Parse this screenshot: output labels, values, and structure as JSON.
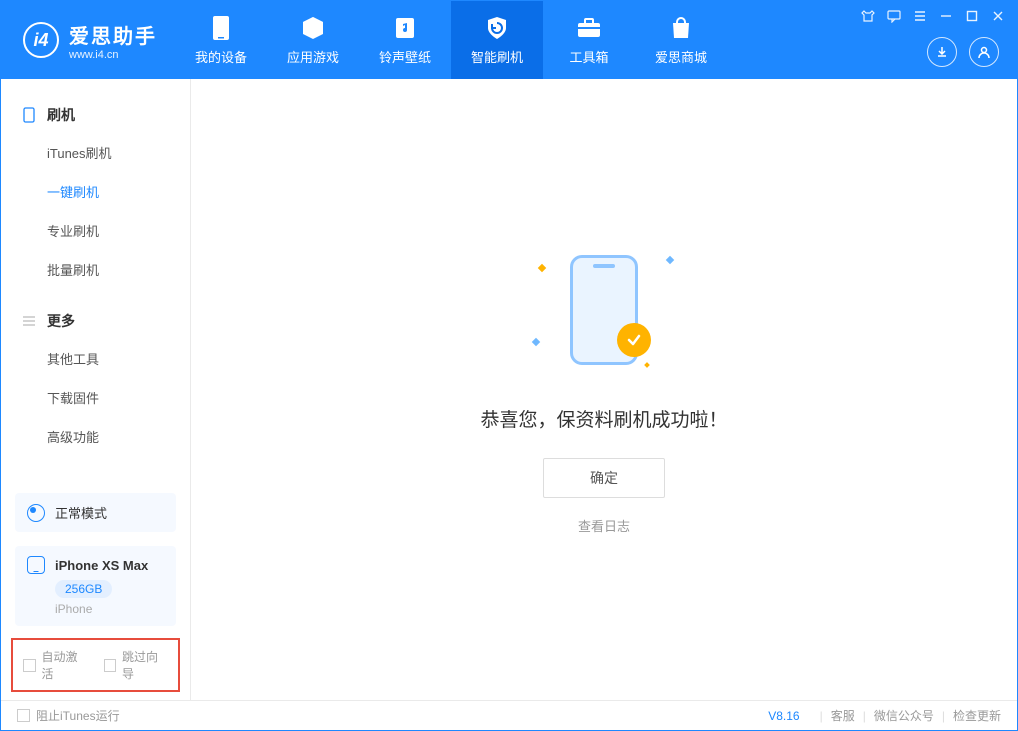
{
  "app": {
    "name": "爱思助手",
    "site": "www.i4.cn"
  },
  "tabs": {
    "device": "我的设备",
    "apps": "应用游戏",
    "ringtone": "铃声壁纸",
    "flash": "智能刷机",
    "toolbox": "工具箱",
    "store": "爱思商城"
  },
  "sidebar": {
    "section1": "刷机",
    "items1": {
      "itunes": "iTunes刷机",
      "onekey": "一键刷机",
      "pro": "专业刷机",
      "batch": "批量刷机"
    },
    "section2": "更多",
    "items2": {
      "other": "其他工具",
      "firmware": "下载固件",
      "advanced": "高级功能"
    }
  },
  "mode": {
    "label": "正常模式"
  },
  "device": {
    "name": "iPhone XS Max",
    "capacity": "256GB",
    "type": "iPhone"
  },
  "opts": {
    "autoActivate": "自动激活",
    "skipGuide": "跳过向导"
  },
  "main": {
    "success": "恭喜您，保资料刷机成功啦！",
    "ok": "确定",
    "log": "查看日志"
  },
  "footer": {
    "blockITunes": "阻止iTunes运行",
    "version": "V8.16",
    "support": "客服",
    "wechat": "微信公众号",
    "update": "检查更新"
  }
}
